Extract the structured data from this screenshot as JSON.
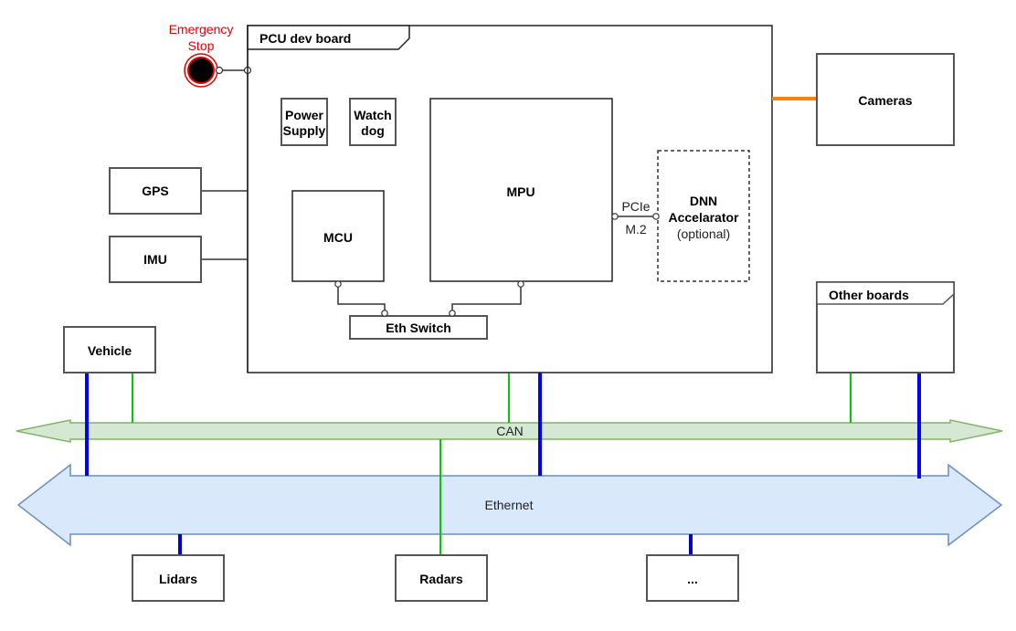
{
  "diagram": {
    "emergency_stop": {
      "line1": "Emergency",
      "line2": "Stop"
    },
    "pcu_board": {
      "title": "PCU dev board"
    },
    "power_supply": {
      "line1": "Power",
      "line2": "Supply"
    },
    "watchdog": {
      "line1": "Watch",
      "line2": "dog"
    },
    "mcu": {
      "label": "MCU"
    },
    "mpu": {
      "label": "MPU"
    },
    "eth_switch": {
      "label": "Eth Switch"
    },
    "dnn": {
      "line1": "DNN",
      "line2": "Accelarator",
      "line3": "(optional)"
    },
    "pcie_link": {
      "top": "PCIe",
      "bottom": "M.2"
    },
    "gps": {
      "label": "GPS"
    },
    "imu": {
      "label": "IMU"
    },
    "vehicle": {
      "label": "Vehicle"
    },
    "cameras": {
      "label": "Cameras"
    },
    "other_boards": {
      "title": "Other boards"
    },
    "can_bus": {
      "label": "CAN"
    },
    "ethernet_bus": {
      "label": "Ethernet"
    },
    "lidars": {
      "label": "Lidars"
    },
    "radars": {
      "label": "Radars"
    },
    "more": {
      "label": "..."
    }
  },
  "colors": {
    "can_fill": "#d5e8d4",
    "can_stroke": "#82b366",
    "eth_fill": "#dae8fc",
    "eth_stroke": "#6c8ebf",
    "can_link": "#00cc00",
    "eth_link": "#0000ff",
    "camera_link": "#ff8000",
    "estop": "#e00000"
  }
}
